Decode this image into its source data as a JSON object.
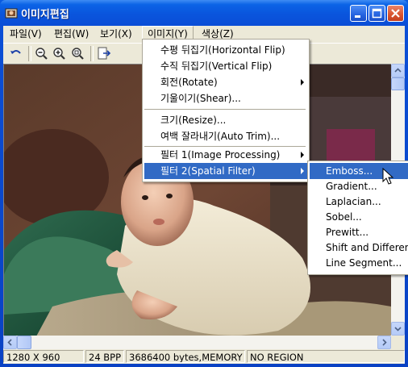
{
  "window": {
    "title": "이미지편집"
  },
  "menubar": {
    "items": [
      {
        "label": "파일(V)"
      },
      {
        "label": "편집(W)"
      },
      {
        "label": "보기(X)"
      },
      {
        "label": "이미지(Y)"
      },
      {
        "label": "색상(Z)"
      }
    ]
  },
  "toolbar": {
    "icons": [
      "undo-icon",
      "zoom-out-icon",
      "zoom-in-icon",
      "zoom-fit-icon",
      "export-icon"
    ]
  },
  "image_menu": {
    "items": [
      {
        "label": "수평 뒤집기(Horizontal Flip)"
      },
      {
        "label": "수직 뒤집기(Vertical Flip)"
      },
      {
        "label": "회전(Rotate)"
      },
      {
        "label": "기울이기(Shear)..."
      },
      {
        "label": "크기(Resize)..."
      },
      {
        "label": "여백 잘라내기(Auto Trim)..."
      },
      {
        "label": "필터 1(Image Processing)"
      },
      {
        "label": "필터 2(Spatial Filter)"
      }
    ]
  },
  "filter2_submenu": {
    "items": [
      {
        "label": "Emboss..."
      },
      {
        "label": "Gradient..."
      },
      {
        "label": "Laplacian..."
      },
      {
        "label": "Sobel..."
      },
      {
        "label": "Prewitt..."
      },
      {
        "label": "Shift and Difference..."
      },
      {
        "label": "Line Segment..."
      }
    ]
  },
  "statusbar": {
    "dimensions": "1280 X 960",
    "bpp": "24 BPP",
    "memory": "3686400 bytes,MEMORY",
    "region": "NO REGION"
  },
  "colors": {
    "titlebar": "#0a55dd",
    "menu_highlight": "#316ac5",
    "chrome": "#ece9d8"
  }
}
